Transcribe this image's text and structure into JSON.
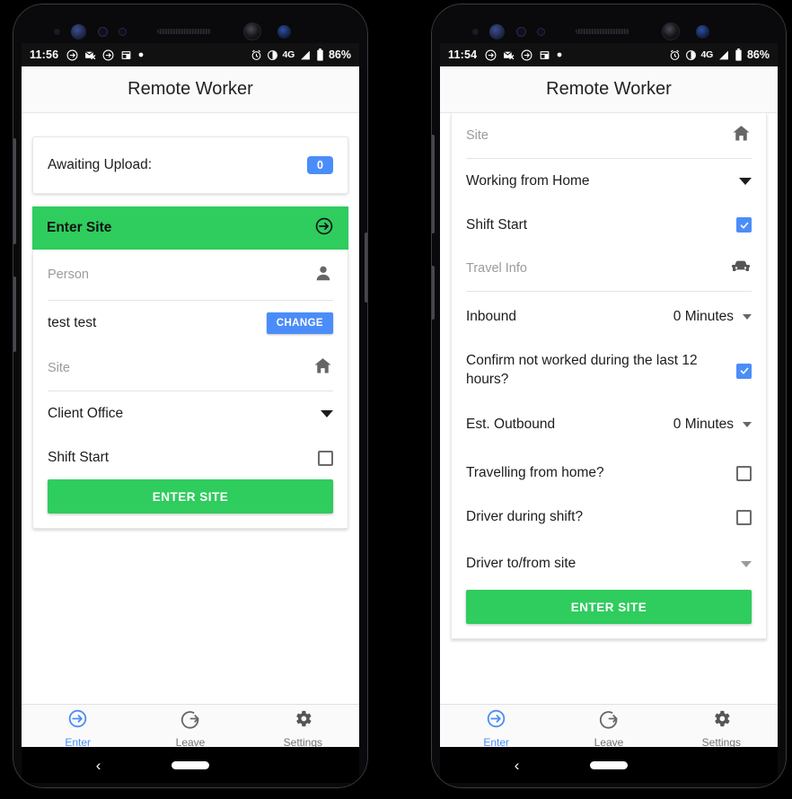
{
  "app": {
    "title": "Remote Worker"
  },
  "phones": [
    {
      "id": "left",
      "status": {
        "time": "11:56",
        "network": "4G",
        "battery": "86%"
      },
      "upload_card": {
        "label": "Awaiting Upload:",
        "count": "0"
      },
      "section_header": {
        "title": "Enter Site",
        "icon": "enter-circle-icon"
      },
      "form": {
        "person_label": "Person",
        "person_icon": "person-icon",
        "person_value": "test test",
        "change_button": "CHANGE",
        "site_label": "Site",
        "site_icon": "home-icon",
        "site_value": "Client Office",
        "shift_start_label": "Shift Start",
        "shift_start_checked": false,
        "submit_button": "ENTER SITE"
      },
      "bottom_nav": [
        {
          "label": "Enter",
          "icon": "enter-circle-icon",
          "active": true
        },
        {
          "label": "Leave",
          "icon": "leave-circle-icon",
          "active": false
        },
        {
          "label": "Settings",
          "icon": "gear-icon",
          "active": false
        }
      ]
    },
    {
      "id": "right",
      "status": {
        "time": "11:54",
        "network": "4G",
        "battery": "86%"
      },
      "form": {
        "site_label": "Site",
        "site_icon": "home-icon",
        "site_value": "Working from Home",
        "shift_start_label": "Shift Start",
        "shift_start_checked": true,
        "travel_info_label": "Travel Info",
        "travel_info_icon": "car-icon",
        "inbound_label": "Inbound",
        "inbound_value": "0 Minutes",
        "confirm_label": "Confirm not worked during the last 12 hours?",
        "confirm_checked": true,
        "outbound_label": "Est. Outbound",
        "outbound_value": "0 Minutes",
        "travelling_label": "Travelling from home?",
        "travelling_checked": false,
        "driver_shift_label": "Driver during shift?",
        "driver_shift_checked": false,
        "driver_tofrom_label": "Driver to/from site",
        "submit_button": "ENTER SITE"
      },
      "bottom_nav": [
        {
          "label": "Enter",
          "icon": "enter-circle-icon",
          "active": true
        },
        {
          "label": "Leave",
          "icon": "leave-circle-icon",
          "active": false
        },
        {
          "label": "Settings",
          "icon": "gear-icon",
          "active": false
        }
      ]
    }
  ],
  "colors": {
    "accent_green": "#2fcc5e",
    "accent_blue": "#4b8df8",
    "statusbar": "#111111",
    "appbar": "#fafafa",
    "muted_text": "#9b9b9b"
  }
}
